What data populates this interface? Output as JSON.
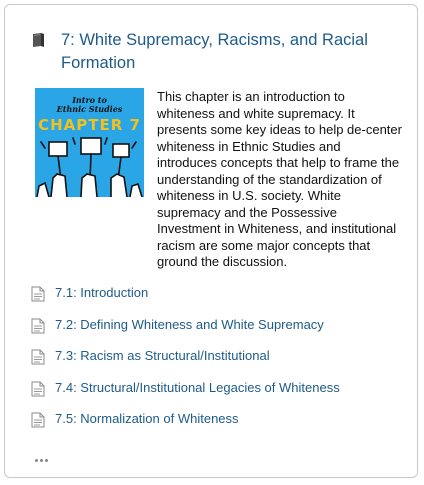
{
  "chapter": {
    "title": "7: White Supremacy, Racisms, and Racial Formation",
    "icon": "book-icon",
    "cover": {
      "line1": "Intro to",
      "line2": "Ethnic Studies",
      "chapter_label": "CHAPTER 7",
      "background": "#2aa6e6",
      "accent": "#f4c01b"
    },
    "description": "This chapter is an introduction to whiteness and white supremacy. It presents some key ideas to help de-center whiteness in Ethnic Studies and introduces concepts that help to frame the understanding of the standardization of whiteness in U.S. society. White supremacy and the Possessive Investment in Whiteness, and institutional racism are some major concepts that ground the discussion."
  },
  "sections": [
    {
      "label": "7.1: Introduction",
      "icon": "page-icon"
    },
    {
      "label": "7.2: Defining Whiteness and White Supremacy",
      "icon": "page-icon"
    },
    {
      "label": "7.3: Racism as Structural/Institutional",
      "icon": "page-icon"
    },
    {
      "label": "7.4: Structural/Institutional Legacies of Whiteness",
      "icon": "page-icon"
    },
    {
      "label": "7.5: Normalization of Whiteness",
      "icon": "page-icon"
    }
  ],
  "more_icon": "ellipsis-icon",
  "colors": {
    "link": "#1e5b8a",
    "border": "#c9c9c9"
  }
}
